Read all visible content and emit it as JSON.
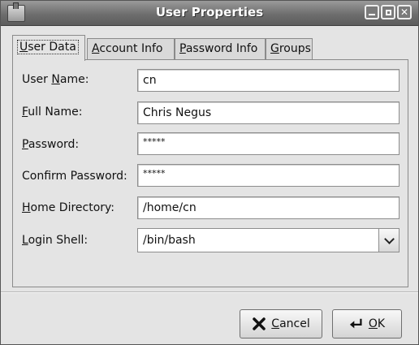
{
  "window": {
    "title": "User Properties",
    "controls": {
      "minimize": "minimize",
      "maximize": "maximize",
      "close": "close"
    },
    "app_icon": "users-icon"
  },
  "tabs": [
    {
      "label": "User Data",
      "mnemonic": "U",
      "active": true
    },
    {
      "label": "Account Info",
      "mnemonic": "A",
      "active": false
    },
    {
      "label": "Password Info",
      "mnemonic": "P",
      "active": false
    },
    {
      "label": "Groups",
      "mnemonic": "G",
      "active": false
    }
  ],
  "form": {
    "user_name": {
      "label": "User Name:",
      "value": "cn"
    },
    "full_name": {
      "label": "Full Name:",
      "value": "Chris Negus"
    },
    "password": {
      "label": "Password:",
      "value": "*****"
    },
    "confirm_password": {
      "label": "Confirm Password:",
      "value": "*****"
    },
    "home_directory": {
      "label": "Home Directory:",
      "value": "/home/cn"
    },
    "login_shell": {
      "label": "Login Shell:",
      "value": "/bin/bash"
    }
  },
  "buttons": {
    "cancel": {
      "label": "Cancel",
      "icon": "x-icon"
    },
    "ok": {
      "label": "OK",
      "icon": "return-arrow-icon"
    }
  }
}
